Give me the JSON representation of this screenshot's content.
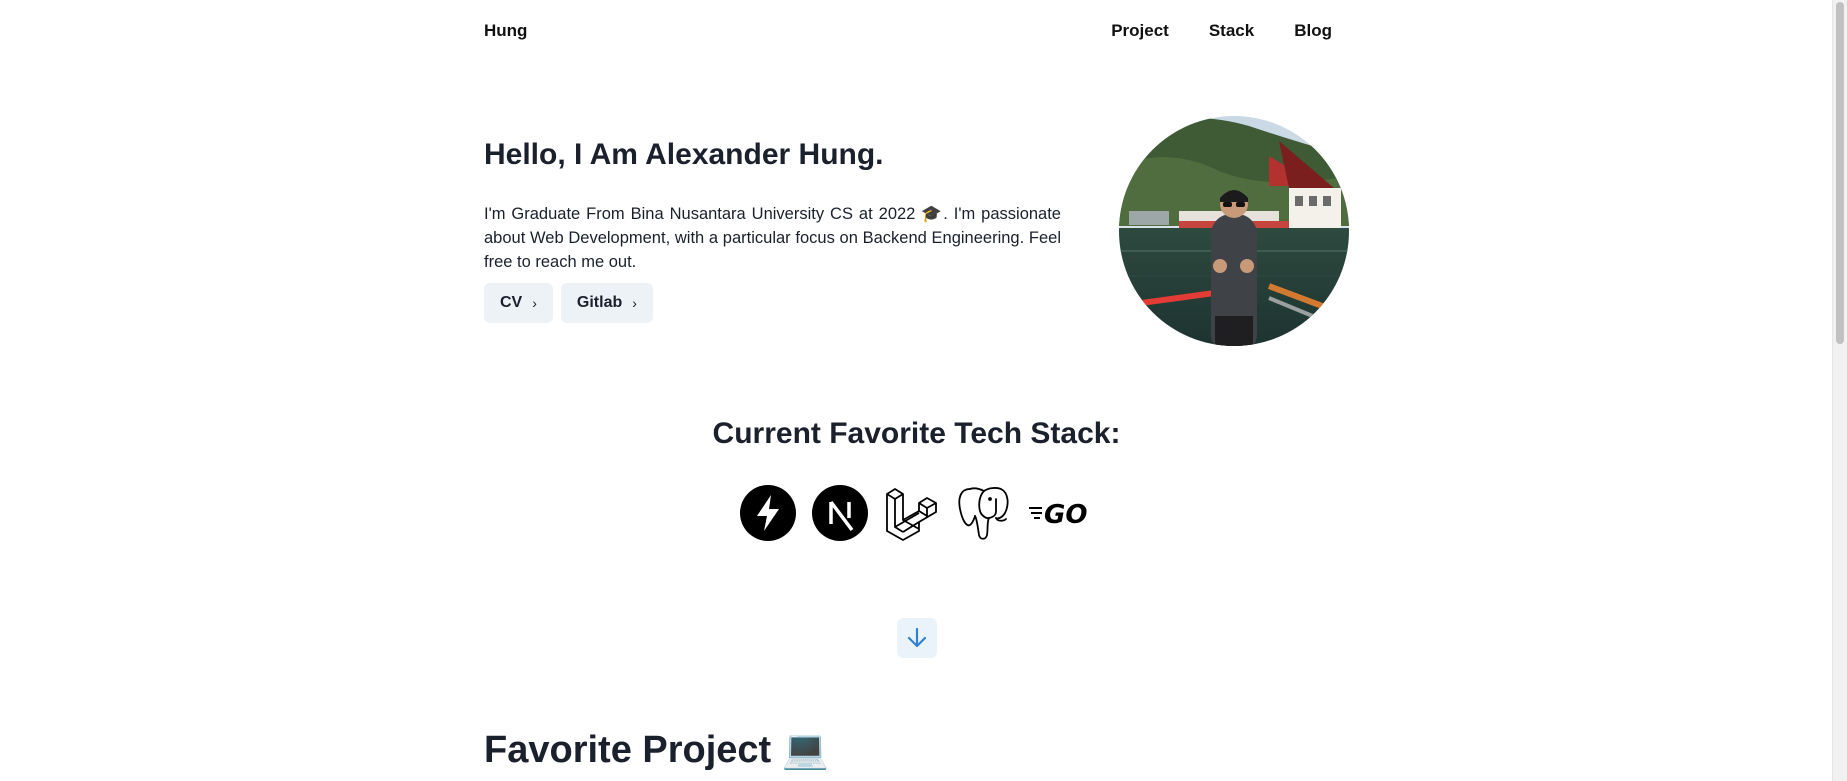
{
  "nav": {
    "brand": "Hung",
    "links": [
      "Project",
      "Stack",
      "Blog"
    ]
  },
  "hero": {
    "title": "Hello, I Am Alexander Hung.",
    "description": "I'm Graduate From Bina Nusantara University CS at 2022 🎓. I'm passionate about Web Development, with a particular focus on Backend Engineering. Feel free to reach me out.",
    "buttons": [
      {
        "label": "CV",
        "icon": "chevron-right-icon"
      },
      {
        "label": "Gitlab",
        "icon": "chevron-right-icon"
      }
    ]
  },
  "stack": {
    "title": "Current Favorite Tech Stack:",
    "icons": [
      "lightning-icon",
      "nextjs-icon",
      "laravel-icon",
      "postgresql-icon",
      "go-icon"
    ],
    "go_label": "GO"
  },
  "scroll_down": {
    "icon": "arrow-down-icon"
  },
  "favorite": {
    "title": "Favorite Project 💻"
  },
  "colors": {
    "text": "#1a202c",
    "button_bg": "#edf2f7",
    "scroll_button_bg": "#ebf3fa",
    "accent_arrow": "#3182ce"
  }
}
